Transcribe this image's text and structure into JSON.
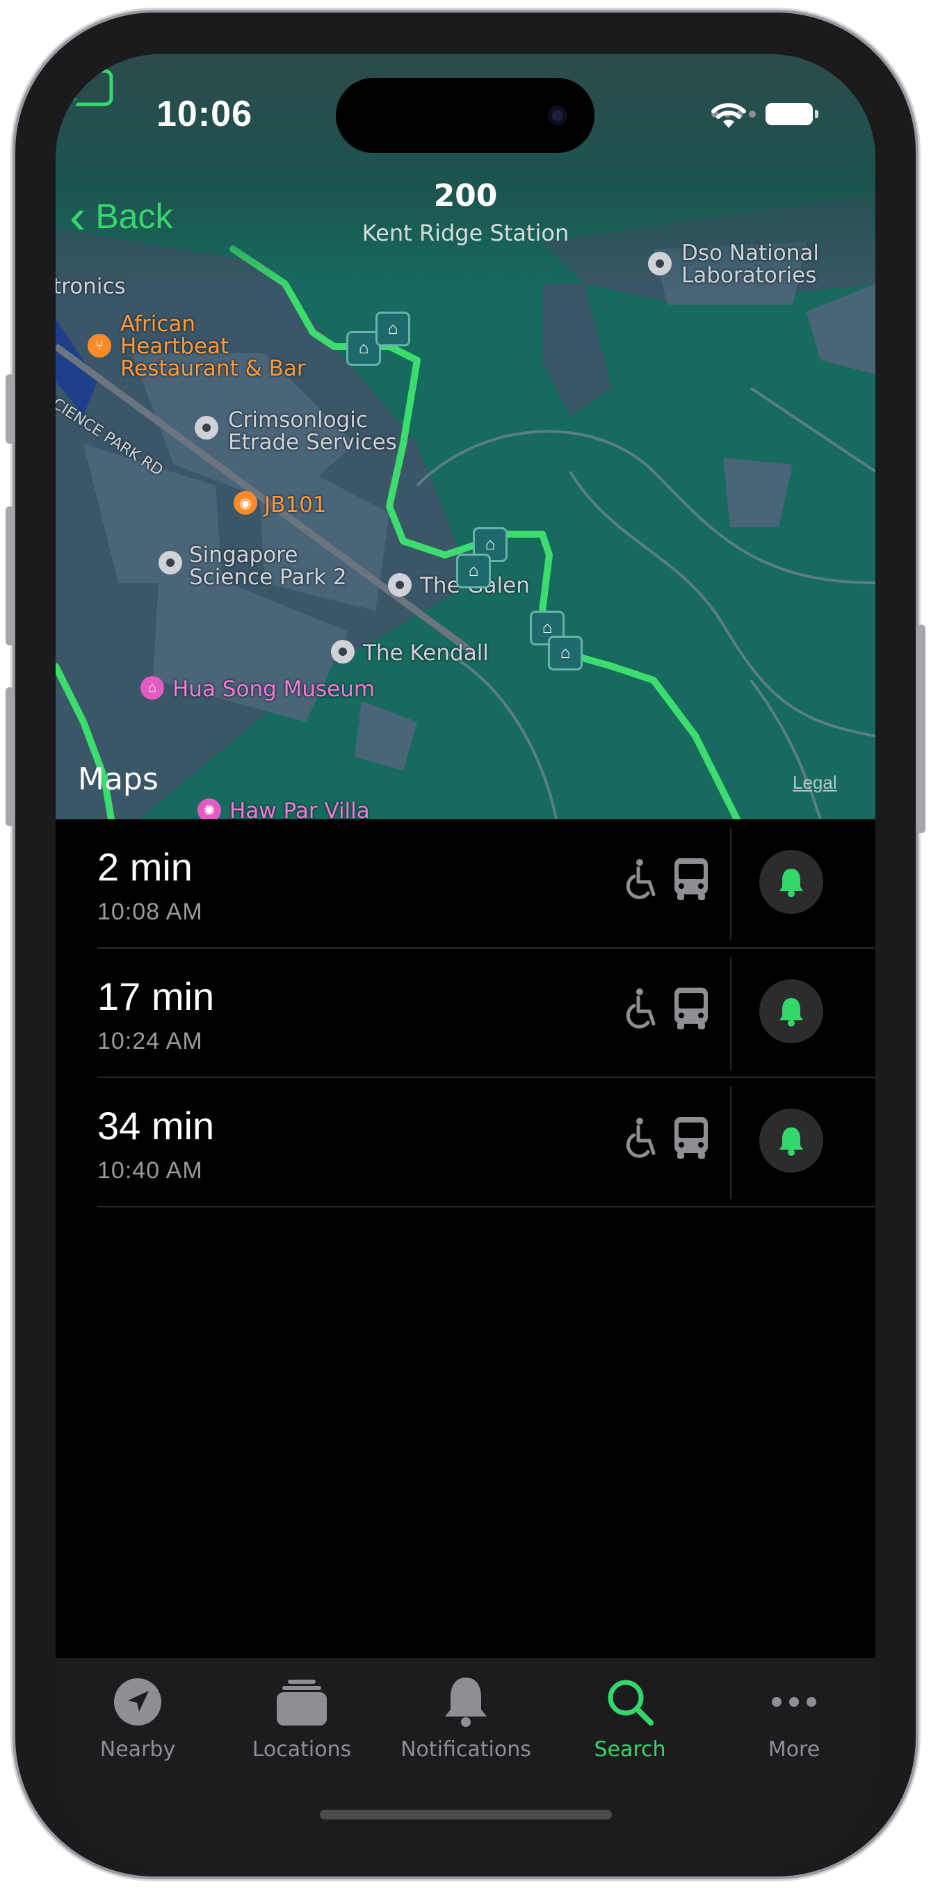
{
  "status_bar": {
    "time": "10:06"
  },
  "nav": {
    "back_label": "Back",
    "title": "200",
    "subtitle": "Kent Ridge Station",
    "add_icon": "add-to-collection-icon"
  },
  "map": {
    "labels": {
      "tronics": "tronics",
      "african": "African\nHeartbeat\nRestaurant & Bar",
      "crimson": "Crimsonlogic\nEtrade Services",
      "jb101": "JB101",
      "singapore": "Singapore\nScience Park 2",
      "galen": "The Galen",
      "kendall": "The Kendall",
      "hua_song": "Hua Song Museum",
      "haw_par": "Haw Par Villa",
      "dso": "Dso National\nLaboratories",
      "road": "SCIENCE PARK RD"
    },
    "brand": "Maps",
    "legal": "Legal",
    "route_color": "#3ddc6e"
  },
  "departures": [
    {
      "minutes": "2 min",
      "time": "10:08 AM"
    },
    {
      "minutes": "17 min",
      "time": "10:24 AM"
    },
    {
      "minutes": "34 min",
      "time": "10:40 AM"
    }
  ],
  "tabs": [
    {
      "label": "Nearby",
      "icon": "location-arrow-icon"
    },
    {
      "label": "Locations",
      "icon": "stacked-cards-icon"
    },
    {
      "label": "Notifications",
      "icon": "bell-icon"
    },
    {
      "label": "Search",
      "icon": "magnifier-icon",
      "active": true
    },
    {
      "label": "More",
      "icon": "ellipsis-icon"
    }
  ],
  "colors": {
    "accent": "#33d86a",
    "background": "#000000",
    "tabbar": "#1c1c1e"
  }
}
